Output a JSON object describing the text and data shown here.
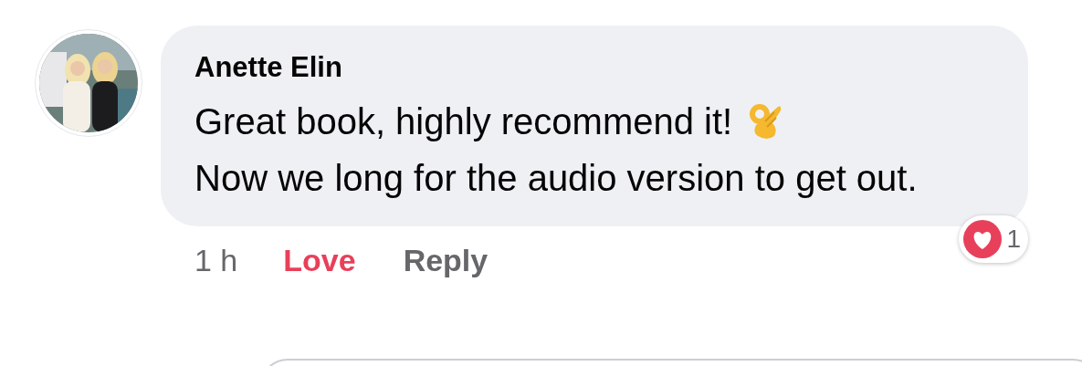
{
  "comment": {
    "author": "Anette Elin",
    "lines": [
      "Great book, highly recommend it!",
      "Now we long for the audio version to get out."
    ],
    "time": "1 h",
    "actions": [
      {
        "label": "Love",
        "selected": true
      },
      {
        "label": "Reply",
        "selected": false
      }
    ],
    "reactions": {
      "count": "1"
    }
  }
}
